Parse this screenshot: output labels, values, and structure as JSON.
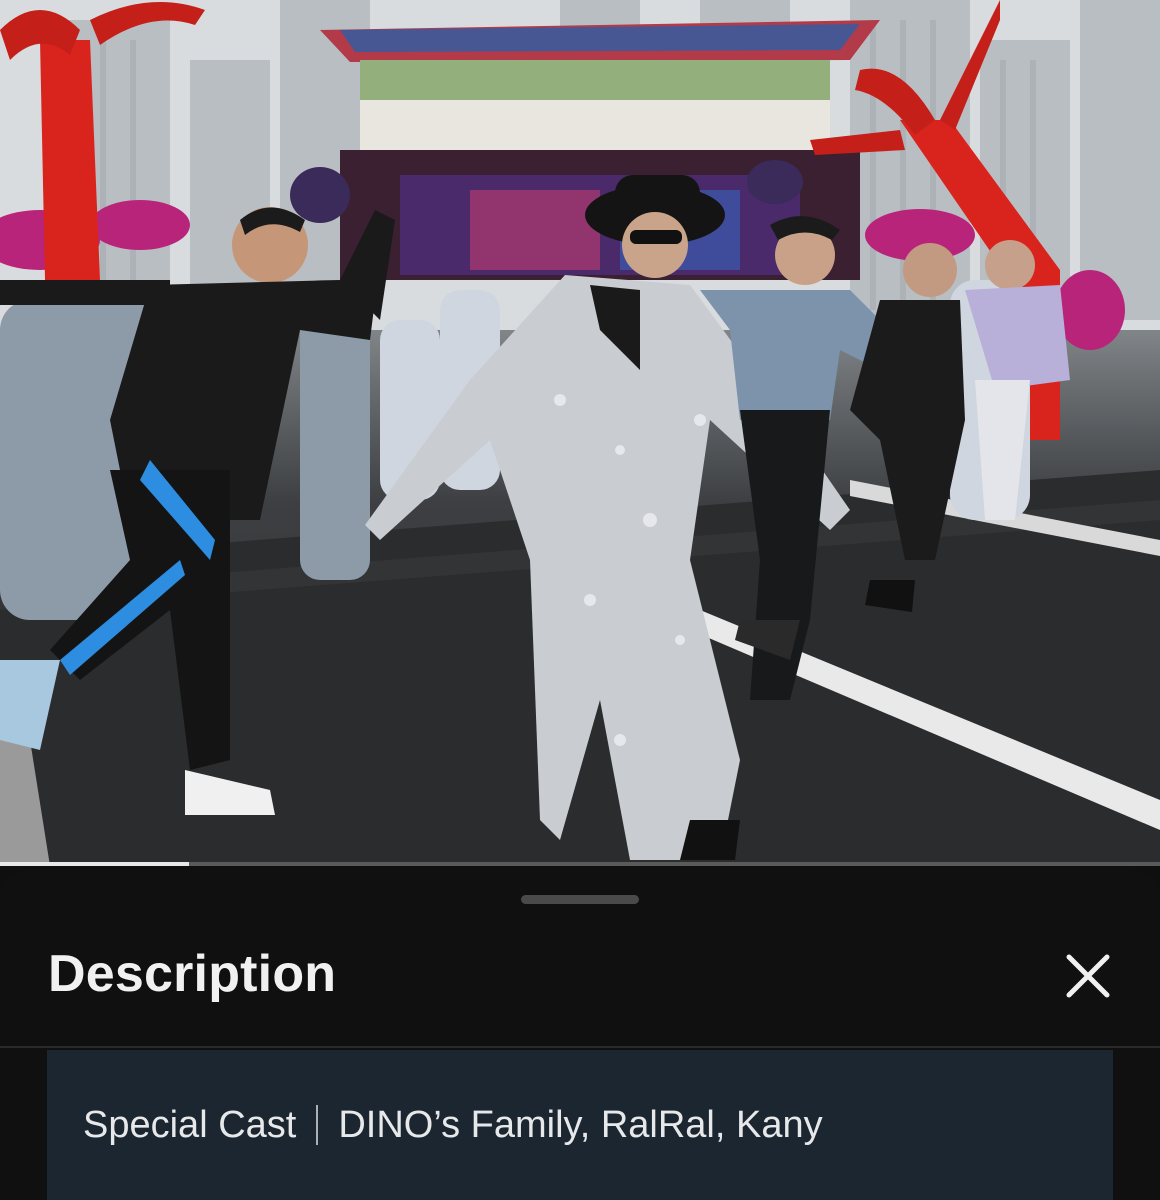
{
  "player": {
    "progress_fraction": 0.163,
    "scene": "street dance scene with a performer in a sequined silver suit and black fedora, dancers, inflatable red tube figures and a festival stage"
  },
  "description_sheet": {
    "title": "Description",
    "close_icon": "close-icon",
    "credit_label": "Special Cast",
    "credit_value": "DINO’s Family, RalRal, Kany"
  },
  "colors": {
    "sheet_background": "#101010",
    "description_box": "#1c2630",
    "progress_fill": "#e8e8e8"
  }
}
